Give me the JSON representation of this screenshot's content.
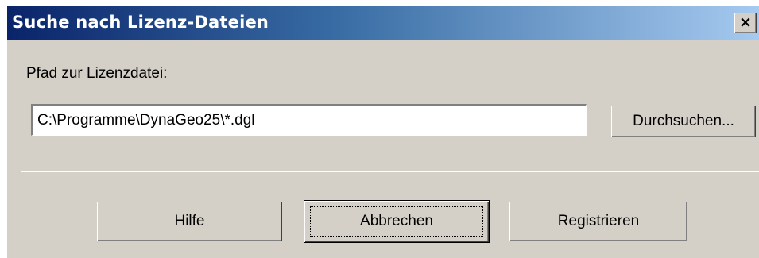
{
  "window": {
    "title": "Suche nach Lizenz-Dateien",
    "close_icon": "close-icon",
    "close_glyph": "×"
  },
  "form": {
    "path_label": "Pfad zur Lizenzdatei:",
    "path_value": "C:\\Programme\\DynaGeo25\\*.dgl",
    "browse_label": "Durchsuchen..."
  },
  "buttons": {
    "help": "Hilfe",
    "cancel": "Abbrechen",
    "register": "Registrieren"
  },
  "colors": {
    "titlebar_start": "#0a246a",
    "titlebar_end": "#a6caf0",
    "dialog_face": "#d4d0c8"
  }
}
